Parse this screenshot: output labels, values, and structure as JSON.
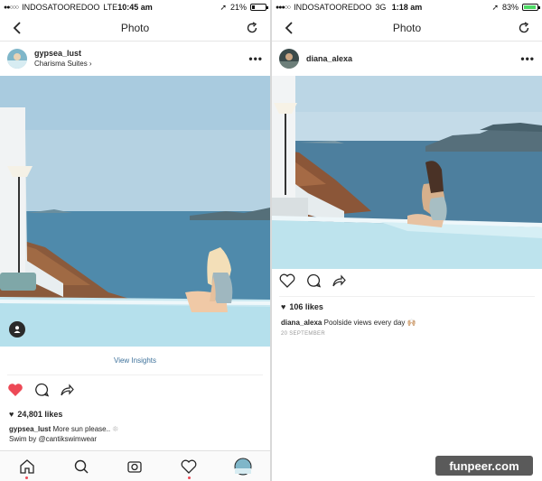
{
  "left": {
    "status": {
      "carrier": "INDOSATOOREDOO",
      "network": "LTE",
      "time": "10:45 am",
      "battery": "21%",
      "battery_level": 0.21
    },
    "nav": {
      "title": "Photo"
    },
    "post": {
      "username": "gypsea_lust",
      "location": "Charisma Suites",
      "insights_label": "View Insights",
      "likes": "24,801 likes",
      "caption_user": "gypsea_lust",
      "caption_text": "More sun please..",
      "caption_line2_prefix": "Swim by",
      "caption_mention": "@cantikswimwear",
      "liked": true
    },
    "tabs": [
      "home-icon",
      "search-icon",
      "camera-icon",
      "heart-icon",
      "profile-icon"
    ]
  },
  "right": {
    "status": {
      "carrier": "INDOSATOOREDOO",
      "network": "3G",
      "time": "1:18 am",
      "battery": "83%",
      "battery_level": 0.83
    },
    "nav": {
      "title": "Photo"
    },
    "post": {
      "username": "diana_alexa",
      "likes": "106 likes",
      "caption_user": "diana_alexa",
      "caption_text": "Poolside views every day 🙌🏼",
      "date": "20 SEPTEMBER"
    }
  },
  "watermark": "funpeer.com",
  "colors": {
    "like_red": "#ed4956",
    "link_blue": "#3f729b",
    "sky": "#a9cde0",
    "sea": "#4b87a8",
    "pool": "#bfe4ee"
  }
}
